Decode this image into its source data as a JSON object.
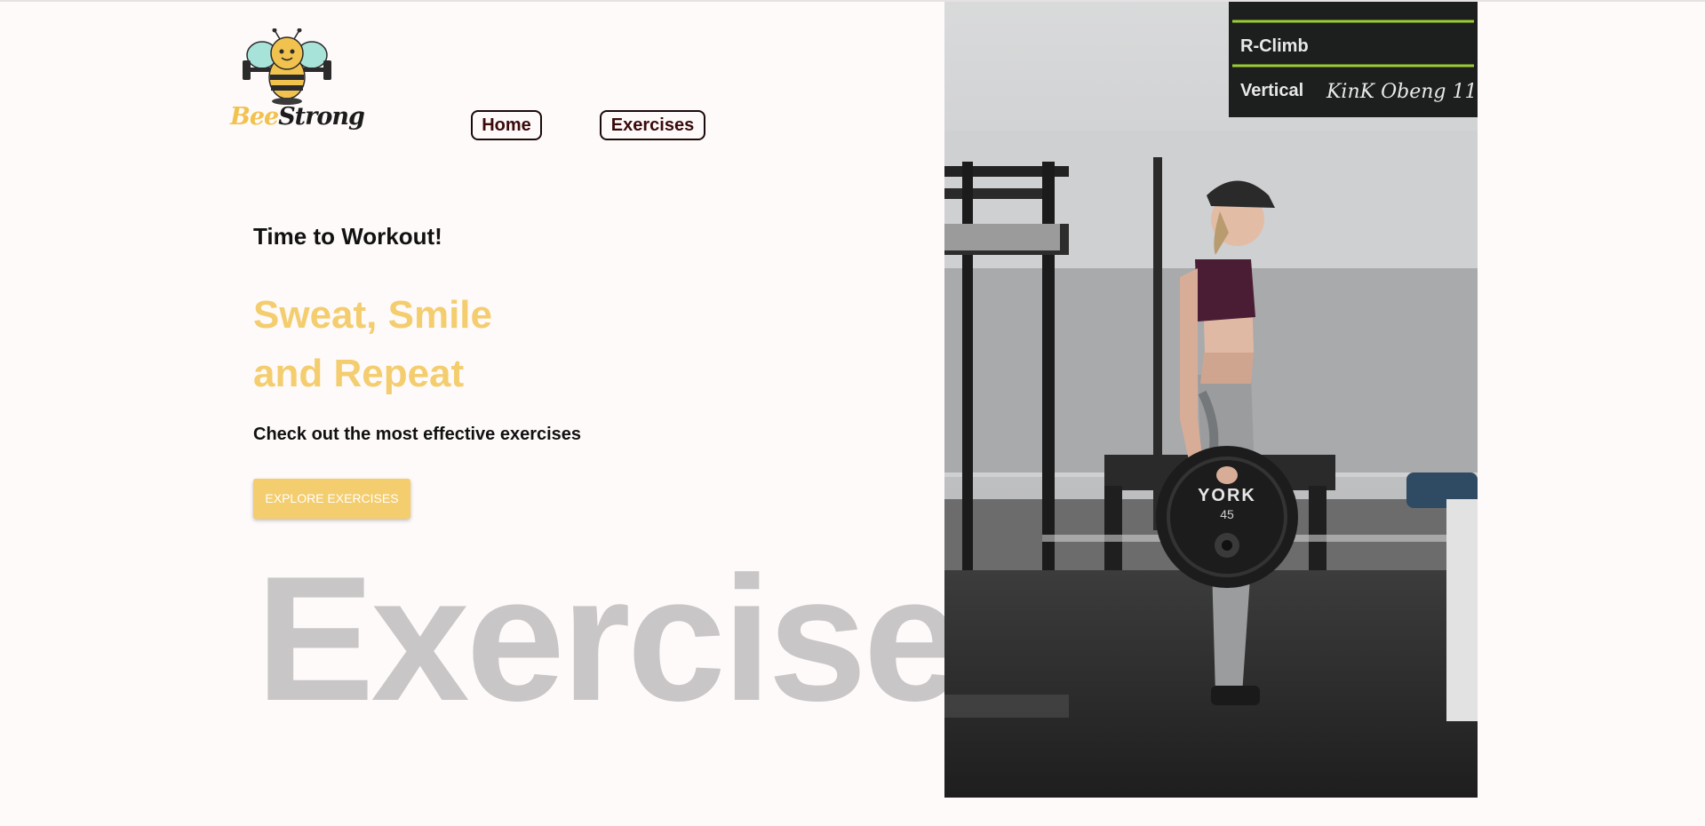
{
  "logo": {
    "word_part1": "Bee",
    "word_part2": "Strong",
    "icon": "bee-dumbbell-mascot"
  },
  "nav": {
    "items": [
      {
        "label": "Home"
      },
      {
        "label": "Exercises"
      }
    ]
  },
  "hero": {
    "kicker": "Time to Workout!",
    "title_line1": "Sweat, Smile",
    "title_line2": "and Repeat",
    "subtitle": "Check out the most effective exercises",
    "cta_label": "EXPLORE EXERCISES",
    "watermark": "Exercise"
  },
  "photo": {
    "subject": "woman-holding-weight-plate-in-gym",
    "plate_brand": "YORK",
    "plate_weight": "45",
    "board_lines": [
      "R-Climb",
      "Vertical",
      "KinK Obeng 11"
    ]
  },
  "colors": {
    "background": "#fffafa",
    "accent": "#f3cd6e",
    "text": "#111111",
    "watermark": "#c9c6c7"
  }
}
